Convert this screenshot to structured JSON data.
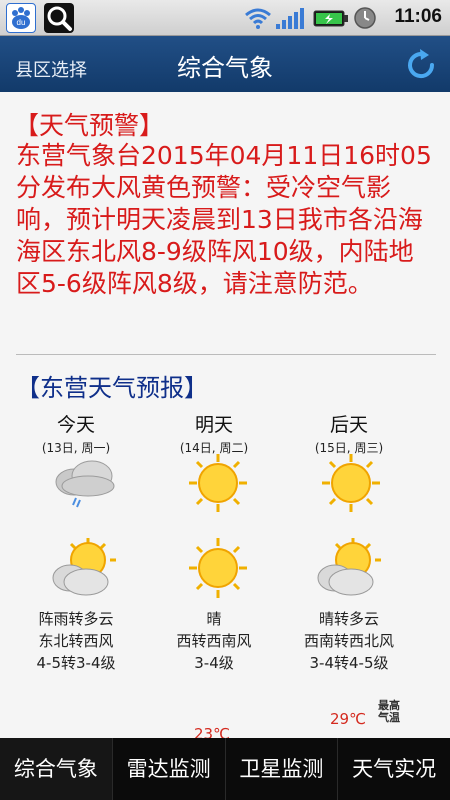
{
  "status": {
    "time": "11:06"
  },
  "header": {
    "left_link": "县区选择",
    "title": "综合气象"
  },
  "warning": {
    "heading": "【天气预警】",
    "body": "东营气象台2015年04月11日16时05分发布大风黄色预警：受冷空气影响，预计明天凌晨到13日我市各沿海海区东北风8-9级阵风10级，内陆地区5-6级阵风8级，请注意防范。"
  },
  "forecast": {
    "heading": "【东营天气预报】",
    "days": [
      {
        "name": "今天",
        "date": "(13日, 周一)",
        "condition": "阵雨转多云",
        "wind": "东北转西风",
        "level": "4-5转3-4级",
        "icon1": "cloud-rain-icon",
        "icon2": "sun-cloud-icon"
      },
      {
        "name": "明天",
        "date": "(14日, 周二)",
        "condition": "晴",
        "wind": "西转西南风",
        "level": "3-4级",
        "icon1": "sun-icon",
        "icon2": "sun-icon"
      },
      {
        "name": "后天",
        "date": "(15日, 周三)",
        "condition": "晴转多云",
        "wind": "西南转西北风",
        "level": "3-4转4-5级",
        "icon1": "sun-icon",
        "icon2": "sun-cloud-icon"
      }
    ]
  },
  "chart": {
    "high_value": "29℃",
    "partial_value": "23℃",
    "legend_label": "最高气温"
  },
  "nav": {
    "items": [
      {
        "label": "综合气象",
        "active": true
      },
      {
        "label": "雷达监测",
        "active": false
      },
      {
        "label": "卫星监测",
        "active": false
      },
      {
        "label": "天气实况",
        "active": false
      }
    ]
  },
  "colors": {
    "warning_red": "#d81b1b",
    "forecast_blue": "#0f2f8a",
    "header_blue": "#1a4679",
    "nav_bg": "#0b0b0b"
  }
}
